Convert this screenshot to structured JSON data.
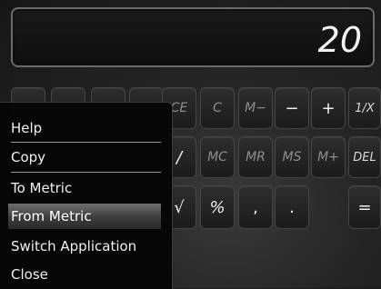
{
  "display": {
    "value": "20"
  },
  "keypad": {
    "row1": [
      "CE",
      "C",
      "M−",
      "−",
      "+",
      "1/X"
    ],
    "row2": [
      "/",
      "MC",
      "MR",
      "MS",
      "M+",
      "DEL"
    ],
    "row3": [
      "√",
      "%",
      ",",
      ".",
      "="
    ]
  },
  "menu": {
    "items": [
      "Help",
      "Copy",
      "To Metric",
      "From Metric",
      "Switch Application",
      "Close"
    ],
    "selected": "From Metric"
  }
}
